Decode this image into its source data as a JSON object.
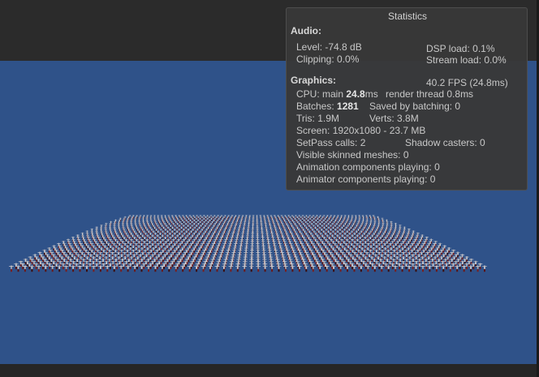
{
  "statistics": {
    "title": "Statistics",
    "audio": {
      "header": "Audio:",
      "level": "Level: -74.8 dB",
      "dsp_load": "DSP load: 0.1%",
      "clipping": "Clipping: 0.0%",
      "stream_load": "Stream load: 0.0%"
    },
    "graphics": {
      "header": "Graphics:",
      "fps": "40.2 FPS (24.8ms)",
      "cpu_prefix": "CPU: main ",
      "cpu_main": "24.8",
      "cpu_suffix": "ms",
      "render_thread": "render thread 0.8ms",
      "batches_prefix": "Batches: ",
      "batches": "1281",
      "saved_by_batching": "Saved by batching: 0",
      "tris": "Tris: 1.9M",
      "verts": "Verts: 3.8M",
      "screen": "Screen: 1920x1080 - 23.7 MB",
      "setpass": "SetPass calls: 2",
      "shadow_casters": "Shadow casters: 0",
      "skinned_meshes": "Visible skinned meshes: 0",
      "animation_components": "Animation components playing: 0",
      "animator_components": "Animator components playing: 0"
    }
  },
  "scene": {
    "sky_color": "#2f5289",
    "ground_color": "#7d7d84"
  }
}
